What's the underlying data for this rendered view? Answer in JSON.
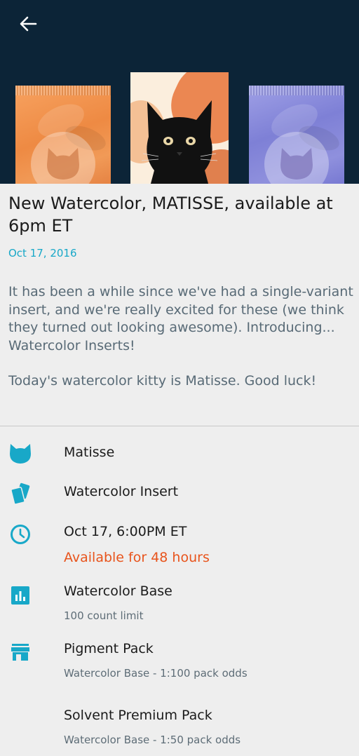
{
  "post": {
    "title": "New Watercolor, MATISSE, available at 6pm ET",
    "date": "Oct 17, 2016",
    "paragraphs": [
      "It has been a while since we've had a single-variant insert, and we're really excited for these (we think they turned out looking awesome). Introducing... Watercolor Inserts!",
      "Today's watercolor kitty is Matisse. Good luck!"
    ]
  },
  "details": {
    "cat_name": "Matisse",
    "insert_type": "Watercolor Insert",
    "release_time": "Oct 17, 6:00PM ET",
    "availability": "Available for 48 hours",
    "base_name": "Watercolor Base",
    "base_limit": "100 count limit",
    "packs": [
      {
        "name": "Pigment Pack",
        "odds": "Watercolor Base - 1:100 pack odds"
      },
      {
        "name": "Solvent Premium Pack",
        "odds": "Watercolor Base - 1:50 pack odds"
      }
    ]
  },
  "icons": {
    "back": "arrow-left-icon",
    "cat": "cat-icon",
    "cards": "cards-icon",
    "clock": "clock-icon",
    "chart": "bar-chart-icon",
    "store": "store-icon"
  },
  "colors": {
    "accent": "#18a8c8",
    "alert": "#e8541c",
    "hero_bg": "#0c2437",
    "pack_orange": "#ee8a43",
    "pack_purple": "#7e80d6"
  }
}
